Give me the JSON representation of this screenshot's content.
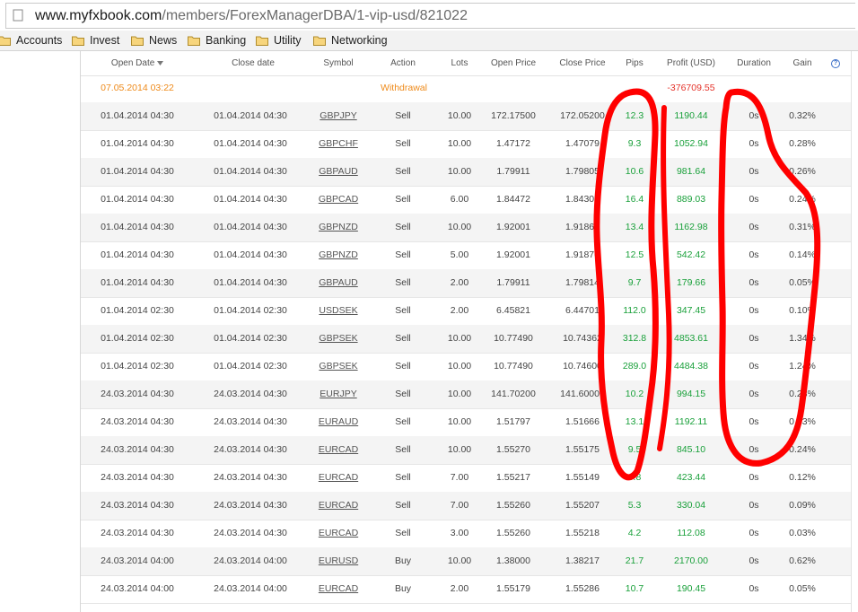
{
  "browser": {
    "url_host": "www.myfxbook.com",
    "url_path": "/members/ForexManagerDBA/1-vip-usd/821022"
  },
  "bookmarks": [
    "Accounts",
    "Invest",
    "News",
    "Banking",
    "Utility",
    "Networking"
  ],
  "table": {
    "headers": [
      "Open Date",
      "Close date",
      "Symbol",
      "Action",
      "Lots",
      "Open Price",
      "Close Price",
      "Pips",
      "Profit (USD)",
      "Duration",
      "Gain"
    ],
    "help_icon_text": "?",
    "withdrawal": {
      "date": "07.05.2014 03:22",
      "action": "Withdrawal",
      "profit": "-376709.55"
    },
    "rows": [
      {
        "open": "01.04.2014 04:30",
        "close": "01.04.2014 04:30",
        "symbol": "GBPJPY",
        "action": "Sell",
        "lots": "10.00",
        "open_price": "172.17500",
        "close_price": "172.05200",
        "pips": "12.3",
        "profit": "1190.44",
        "duration": "0s",
        "gain": "0.32%"
      },
      {
        "open": "01.04.2014 04:30",
        "close": "01.04.2014 04:30",
        "symbol": "GBPCHF",
        "action": "Sell",
        "lots": "10.00",
        "open_price": "1.47172",
        "close_price": "1.47079",
        "pips": "9.3",
        "profit": "1052.94",
        "duration": "0s",
        "gain": "0.28%"
      },
      {
        "open": "01.04.2014 04:30",
        "close": "01.04.2014 04:30",
        "symbol": "GBPAUD",
        "action": "Sell",
        "lots": "10.00",
        "open_price": "1.79911",
        "close_price": "1.79805",
        "pips": "10.6",
        "profit": "981.64",
        "duration": "0s",
        "gain": "0.26%"
      },
      {
        "open": "01.04.2014 04:30",
        "close": "01.04.2014 04:30",
        "symbol": "GBPCAD",
        "action": "Sell",
        "lots": "6.00",
        "open_price": "1.84472",
        "close_price": "1.84308",
        "pips": "16.4",
        "profit": "889.03",
        "duration": "0s",
        "gain": "0.24%"
      },
      {
        "open": "01.04.2014 04:30",
        "close": "01.04.2014 04:30",
        "symbol": "GBPNZD",
        "action": "Sell",
        "lots": "10.00",
        "open_price": "1.92001",
        "close_price": "1.91867",
        "pips": "13.4",
        "profit": "1162.98",
        "duration": "0s",
        "gain": "0.31%"
      },
      {
        "open": "01.04.2014 04:30",
        "close": "01.04.2014 04:30",
        "symbol": "GBPNZD",
        "action": "Sell",
        "lots": "5.00",
        "open_price": "1.92001",
        "close_price": "1.91876",
        "pips": "12.5",
        "profit": "542.42",
        "duration": "0s",
        "gain": "0.14%"
      },
      {
        "open": "01.04.2014 04:30",
        "close": "01.04.2014 04:30",
        "symbol": "GBPAUD",
        "action": "Sell",
        "lots": "2.00",
        "open_price": "1.79911",
        "close_price": "1.79814",
        "pips": "9.7",
        "profit": "179.66",
        "duration": "0s",
        "gain": "0.05%"
      },
      {
        "open": "01.04.2014 02:30",
        "close": "01.04.2014 02:30",
        "symbol": "USDSEK",
        "action": "Sell",
        "lots": "2.00",
        "open_price": "6.45821",
        "close_price": "6.44701",
        "pips": "112.0",
        "profit": "347.45",
        "duration": "0s",
        "gain": "0.10%"
      },
      {
        "open": "01.04.2014 02:30",
        "close": "01.04.2014 02:30",
        "symbol": "GBPSEK",
        "action": "Sell",
        "lots": "10.00",
        "open_price": "10.77490",
        "close_price": "10.74362",
        "pips": "312.8",
        "profit": "4853.61",
        "duration": "0s",
        "gain": "1.34%"
      },
      {
        "open": "01.04.2014 02:30",
        "close": "01.04.2014 02:30",
        "symbol": "GBPSEK",
        "action": "Sell",
        "lots": "10.00",
        "open_price": "10.77490",
        "close_price": "10.74600",
        "pips": "289.0",
        "profit": "4484.38",
        "duration": "0s",
        "gain": "1.24%"
      },
      {
        "open": "24.03.2014 04:30",
        "close": "24.03.2014 04:30",
        "symbol": "EURJPY",
        "action": "Sell",
        "lots": "10.00",
        "open_price": "141.70200",
        "close_price": "141.60000",
        "pips": "10.2",
        "profit": "994.15",
        "duration": "0s",
        "gain": "0.28%"
      },
      {
        "open": "24.03.2014 04:30",
        "close": "24.03.2014 04:30",
        "symbol": "EURAUD",
        "action": "Sell",
        "lots": "10.00",
        "open_price": "1.51797",
        "close_price": "1.51666",
        "pips": "13.1",
        "profit": "1192.11",
        "duration": "0s",
        "gain": "0.33%"
      },
      {
        "open": "24.03.2014 04:30",
        "close": "24.03.2014 04:30",
        "symbol": "EURCAD",
        "action": "Sell",
        "lots": "10.00",
        "open_price": "1.55270",
        "close_price": "1.55175",
        "pips": "9.5",
        "profit": "845.10",
        "duration": "0s",
        "gain": "0.24%"
      },
      {
        "open": "24.03.2014 04:30",
        "close": "24.03.2014 04:30",
        "symbol": "EURCAD",
        "action": "Sell",
        "lots": "7.00",
        "open_price": "1.55217",
        "close_price": "1.55149",
        "pips": "6.8",
        "profit": "423.44",
        "duration": "0s",
        "gain": "0.12%"
      },
      {
        "open": "24.03.2014 04:30",
        "close": "24.03.2014 04:30",
        "symbol": "EURCAD",
        "action": "Sell",
        "lots": "7.00",
        "open_price": "1.55260",
        "close_price": "1.55207",
        "pips": "5.3",
        "profit": "330.04",
        "duration": "0s",
        "gain": "0.09%"
      },
      {
        "open": "24.03.2014 04:30",
        "close": "24.03.2014 04:30",
        "symbol": "EURCAD",
        "action": "Sell",
        "lots": "3.00",
        "open_price": "1.55260",
        "close_price": "1.55218",
        "pips": "4.2",
        "profit": "112.08",
        "duration": "0s",
        "gain": "0.03%"
      },
      {
        "open": "24.03.2014 04:00",
        "close": "24.03.2014 04:00",
        "symbol": "EURUSD",
        "action": "Buy",
        "lots": "10.00",
        "open_price": "1.38000",
        "close_price": "1.38217",
        "pips": "21.7",
        "profit": "2170.00",
        "duration": "0s",
        "gain": "0.62%"
      },
      {
        "open": "24.03.2014 04:00",
        "close": "24.03.2014 04:00",
        "symbol": "EURCAD",
        "action": "Buy",
        "lots": "2.00",
        "open_price": "1.55179",
        "close_price": "1.55286",
        "pips": "10.7",
        "profit": "190.45",
        "duration": "0s",
        "gain": "0.05%"
      }
    ]
  },
  "colors": {
    "profit_green": "#19a03a",
    "withdrawal_orange": "#ee8a1a",
    "negative_red": "#e5342b",
    "annotation_red": "#ff0000"
  }
}
